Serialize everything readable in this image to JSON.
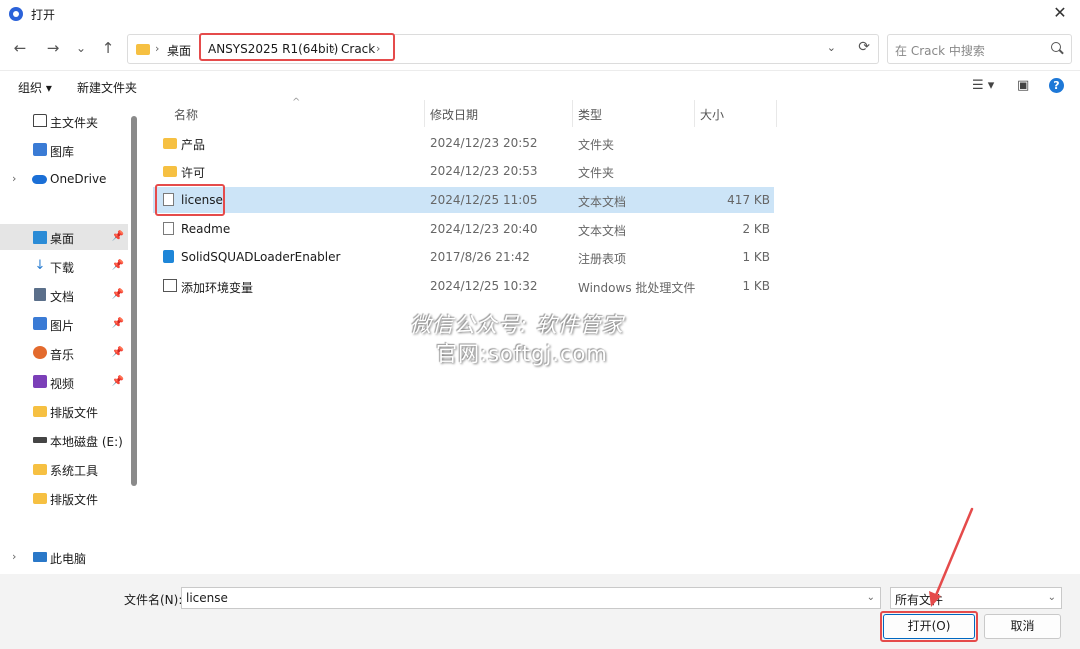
{
  "window": {
    "title": "打开",
    "close_glyph": "✕"
  },
  "nav": {
    "back": "←",
    "forward": "→",
    "recent": "⌄",
    "up": "↑",
    "breadcrumbs": [
      "桌面",
      "ANSYS2025 R1(64bit)",
      "Crack"
    ],
    "separators": [
      "›",
      "›",
      "›"
    ],
    "dropdown": "⌄",
    "refresh": "⟳",
    "search_placeholder": "在 Crack 中搜索"
  },
  "toolbar": {
    "organize": "组织 ▾",
    "new_folder": "新建文件夹",
    "view_icon": "☰ ▾",
    "pane_icon": "▣",
    "help": "?"
  },
  "sidebar": {
    "items": [
      {
        "label": "主文件夹",
        "icon": "home-icon"
      },
      {
        "label": "图库",
        "icon": "gallery-icon"
      },
      {
        "label": "OneDrive",
        "icon": "cloud-icon"
      },
      {
        "label": "桌面",
        "icon": "desktop-icon",
        "pinned": true,
        "selected": true
      },
      {
        "label": "下载",
        "icon": "download-icon",
        "pinned": true
      },
      {
        "label": "文档",
        "icon": "document-icon",
        "pinned": true
      },
      {
        "label": "图片",
        "icon": "pictures-icon",
        "pinned": true
      },
      {
        "label": "音乐",
        "icon": "music-icon",
        "pinned": true
      },
      {
        "label": "视频",
        "icon": "video-icon",
        "pinned": true
      },
      {
        "label": "排版文件",
        "icon": "folder-icon"
      },
      {
        "label": "本地磁盘 (E:)",
        "icon": "drive-icon"
      },
      {
        "label": "系统工具",
        "icon": "folder-icon"
      },
      {
        "label": "排版文件",
        "icon": "folder-icon"
      },
      {
        "label": "此电脑",
        "icon": "pc-icon"
      }
    ],
    "chevron": "›",
    "pin": "📌"
  },
  "columns": {
    "name": "名称",
    "date": "修改日期",
    "type": "类型",
    "size": "大小"
  },
  "files": [
    {
      "name": "产品",
      "date": "2024/12/23 20:52",
      "type": "文件夹",
      "size": "",
      "icon": "folder-icon"
    },
    {
      "name": "许可",
      "date": "2024/12/23 20:53",
      "type": "文件夹",
      "size": "",
      "icon": "folder-icon"
    },
    {
      "name": "license",
      "date": "2024/12/25 11:05",
      "type": "文本文档",
      "size": "417 KB",
      "icon": "text-file-icon",
      "selected": true
    },
    {
      "name": "Readme",
      "date": "2024/12/23 20:40",
      "type": "文本文档",
      "size": "2 KB",
      "icon": "text-file-icon"
    },
    {
      "name": "SolidSQUADLoaderEnabler",
      "date": "2017/8/26 21:42",
      "type": "注册表项",
      "size": "1 KB",
      "icon": "registry-icon"
    },
    {
      "name": "添加环境变量",
      "date": "2024/12/25 10:32",
      "type": "Windows 批处理文件",
      "size": "1 KB",
      "icon": "batch-file-icon"
    }
  ],
  "watermark": {
    "line1": "微信公众号: 软件管家",
    "line2": "官网:softgj.com"
  },
  "bottom": {
    "filename_label": "文件名(N):",
    "filename_value": "license",
    "filetype_value": "所有文件",
    "open_button": "打开(O)",
    "cancel_button": "取消",
    "chevron": "⌄"
  },
  "colors": {
    "highlight": "#e54b4b",
    "selection": "#cce4f7",
    "accent": "#0067c0"
  }
}
